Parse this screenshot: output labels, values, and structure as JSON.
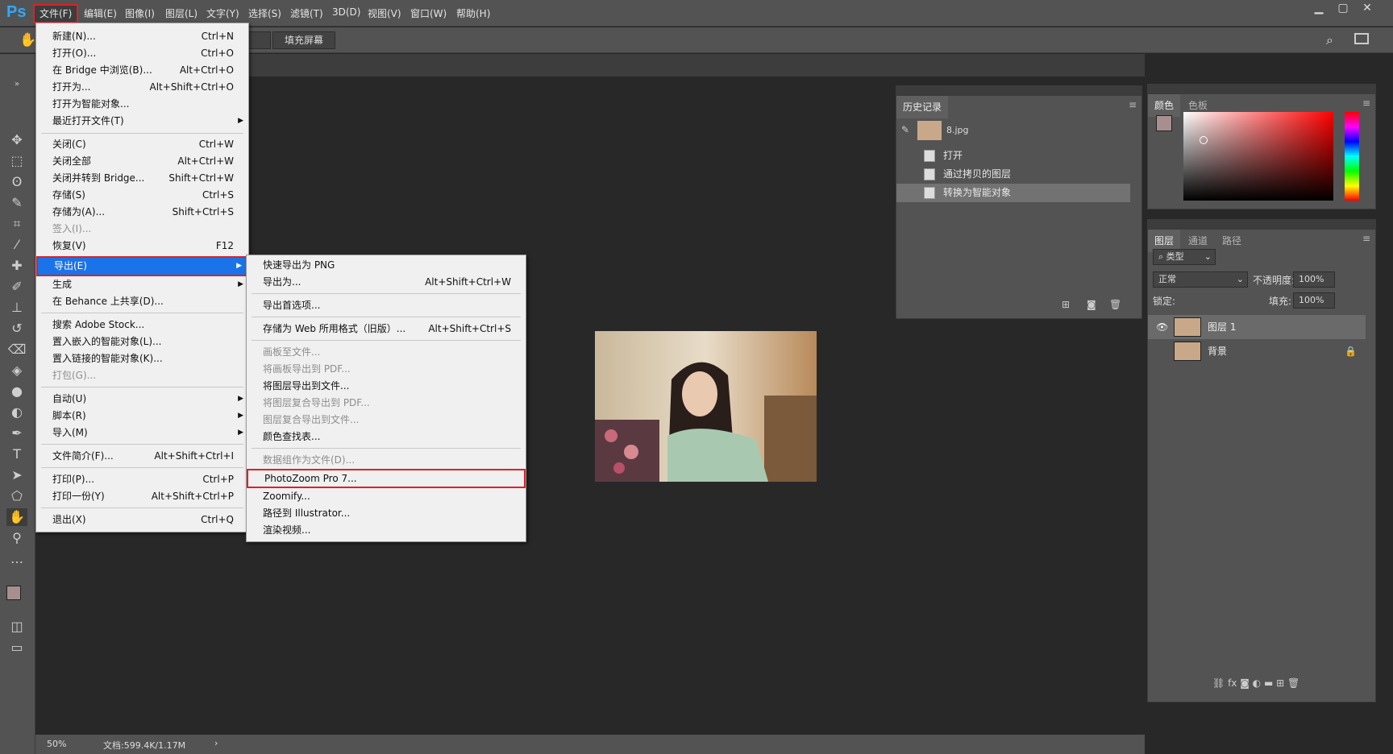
{
  "app": {
    "logo": "Ps"
  },
  "menubar": {
    "items": [
      {
        "label": "文件(F)"
      },
      {
        "label": "编辑(E)"
      },
      {
        "label": "图像(I)"
      },
      {
        "label": "图层(L)"
      },
      {
        "label": "文字(Y)"
      },
      {
        "label": "选择(S)"
      },
      {
        "label": "滤镜(T)"
      },
      {
        "label": "3D(D)"
      },
      {
        "label": "视图(V)"
      },
      {
        "label": "窗口(W)"
      },
      {
        "label": "帮助(H)"
      }
    ]
  },
  "options": {
    "fill_screen": "填充屏幕"
  },
  "file_menu": {
    "items": [
      {
        "label": "新建(N)...",
        "shortcut": "Ctrl+N"
      },
      {
        "label": "打开(O)...",
        "shortcut": "Ctrl+O"
      },
      {
        "label": "在 Bridge 中浏览(B)...",
        "shortcut": "Alt+Ctrl+O"
      },
      {
        "label": "打开为...",
        "shortcut": "Alt+Shift+Ctrl+O"
      },
      {
        "label": "打开为智能对象...",
        "shortcut": ""
      },
      {
        "label": "最近打开文件(T)",
        "shortcut": ""
      },
      {
        "label": "关闭(C)",
        "shortcut": "Ctrl+W"
      },
      {
        "label": "关闭全部",
        "shortcut": "Alt+Ctrl+W"
      },
      {
        "label": "关闭并转到 Bridge...",
        "shortcut": "Shift+Ctrl+W"
      },
      {
        "label": "存储(S)",
        "shortcut": "Ctrl+S"
      },
      {
        "label": "存储为(A)...",
        "shortcut": "Shift+Ctrl+S"
      },
      {
        "label": "签入(I)...",
        "shortcut": ""
      },
      {
        "label": "恢复(V)",
        "shortcut": "F12"
      },
      {
        "label": "导出(E)",
        "shortcut": ""
      },
      {
        "label": "生成",
        "shortcut": ""
      },
      {
        "label": "在 Behance 上共享(D)...",
        "shortcut": ""
      },
      {
        "label": "搜索 Adobe Stock...",
        "shortcut": ""
      },
      {
        "label": "置入嵌入的智能对象(L)...",
        "shortcut": ""
      },
      {
        "label": "置入链接的智能对象(K)...",
        "shortcut": ""
      },
      {
        "label": "打包(G)...",
        "shortcut": ""
      },
      {
        "label": "自动(U)",
        "shortcut": ""
      },
      {
        "label": "脚本(R)",
        "shortcut": ""
      },
      {
        "label": "导入(M)",
        "shortcut": ""
      },
      {
        "label": "文件简介(F)...",
        "shortcut": "Alt+Shift+Ctrl+I"
      },
      {
        "label": "打印(P)...",
        "shortcut": "Ctrl+P"
      },
      {
        "label": "打印一份(Y)",
        "shortcut": "Alt+Shift+Ctrl+P"
      },
      {
        "label": "退出(X)",
        "shortcut": "Ctrl+Q"
      }
    ]
  },
  "export_menu": {
    "items": [
      {
        "label": "快速导出为 PNG",
        "shortcut": ""
      },
      {
        "label": "导出为...",
        "shortcut": "Alt+Shift+Ctrl+W"
      },
      {
        "label": "导出首选项...",
        "shortcut": ""
      },
      {
        "label": "存储为 Web 所用格式（旧版）...",
        "shortcut": "Alt+Shift+Ctrl+S"
      },
      {
        "label": "画板至文件...",
        "shortcut": ""
      },
      {
        "label": "将画板导出到 PDF...",
        "shortcut": ""
      },
      {
        "label": "将图层导出到文件...",
        "shortcut": ""
      },
      {
        "label": "将图层复合导出到 PDF...",
        "shortcut": ""
      },
      {
        "label": "图层复合导出到文件...",
        "shortcut": ""
      },
      {
        "label": "颜色查找表...",
        "shortcut": ""
      },
      {
        "label": "数据组作为文件(D)...",
        "shortcut": ""
      },
      {
        "label": "PhotoZoom Pro 7...",
        "shortcut": ""
      },
      {
        "label": "Zoomify...",
        "shortcut": ""
      },
      {
        "label": "路径到 Illustrator...",
        "shortcut": ""
      },
      {
        "label": "渲染视频...",
        "shortcut": ""
      }
    ]
  },
  "history": {
    "tab": "历史记录",
    "snapshot": "8.jpg",
    "states": [
      "打开",
      "通过拷贝的图层",
      "转换为智能对象"
    ]
  },
  "color_panel": {
    "tabs": [
      "颜色",
      "色板"
    ],
    "foreground": "#a88f8f",
    "background": "#ffffff"
  },
  "layers": {
    "tabs": [
      "图层",
      "通道",
      "路径"
    ],
    "filter": "类型",
    "blend_mode": "正常",
    "opacity_label": "不透明度:",
    "opacity": "100%",
    "lock_label": "锁定:",
    "fill_label": "填充:",
    "fill": "100%",
    "items": [
      {
        "name": "图层 1"
      },
      {
        "name": "背景"
      }
    ]
  },
  "status": {
    "zoom": "50%",
    "doc": "文档:599.4K/1.17M"
  }
}
